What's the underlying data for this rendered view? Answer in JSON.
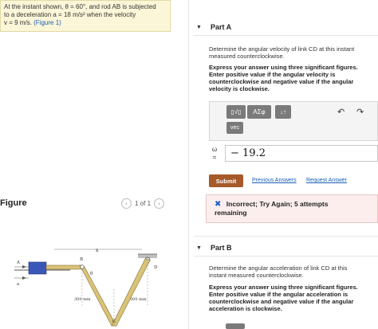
{
  "problem": {
    "line1": "At the instant shown, θ = 60°, and rod AB is subjected",
    "line2": "to a deceleration a = 18 m/s² when the velocity",
    "line3_prefix": "v = 9 m/s.",
    "figure_link": "(Figure 1)"
  },
  "figure_panel": {
    "title": "Figure",
    "pager": "1 of 1",
    "prev_symbol": "‹",
    "next_symbol": "›",
    "labels": {
      "x": "x",
      "A": "A",
      "B": "B",
      "D": "D",
      "C": "C",
      "a": "a",
      "theta": "θ",
      "len_left": "300 mm",
      "len_right": "300 mm"
    }
  },
  "part_a": {
    "label": "Part A",
    "prompt_line1": "Determine the angular velocity of link CD at this instant",
    "prompt_line2": "measured counterclockwise.",
    "instructions": [
      "Express your answer using three significant figures.",
      "Enter positive value if the angular velocity is",
      "counterclockwise and negative value if the angular",
      "velocity is clockwise."
    ],
    "toolbar": {
      "templates": "▯√▯",
      "greek": "ΑΣφ",
      "sort": "↓↑",
      "undo": "↶",
      "redo": "↷",
      "vec": "vec"
    },
    "answer_symbol": "ω",
    "answer_equals": "=",
    "answer_value": "− 19.2",
    "submit_label": "Submit",
    "previous_answers": "Previous Answers",
    "request_answer": "Request Answer",
    "feedback_icon": "✖",
    "feedback_title": "Incorrect; Try Again; 5 attempts",
    "feedback_sub": "remaining"
  },
  "part_b": {
    "label": "Part B",
    "prompt_line1": "Determine the angular acceleration of link CD at this",
    "prompt_line2": "instant measured counterclockwise.",
    "instructions": [
      "Express your answer using three significant figures.",
      "Enter positive value if the angular acceleration is",
      "counterclockwise and negative value if the angular",
      "acceleration is clockwise."
    ]
  },
  "colors": {
    "accent": "#a65a2a",
    "link": "#1a5fb4",
    "feedback_bg": "#fdeeee",
    "problem_bg": "#fbf6d8"
  }
}
